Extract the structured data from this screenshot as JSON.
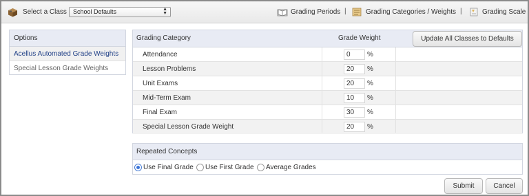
{
  "topbar": {
    "select_class_label": "Select a Class",
    "class_select": {
      "value": "School Defaults"
    },
    "links": {
      "grading_periods": "Grading Periods",
      "grading_categories": "Grading Categories / Weights",
      "grading_scale": "Grading Scale"
    },
    "separator": "|",
    "icons": [
      "box-icon",
      "book-icon",
      "folder-icon",
      "scale-icon"
    ]
  },
  "options": {
    "header": "Options",
    "items": [
      {
        "label": "Acellus Automated Grade Weights",
        "active": true
      },
      {
        "label": "Special Lesson Grade Weights",
        "active": false
      }
    ]
  },
  "grade_table": {
    "columns": {
      "category": "Grading Category",
      "weight": "Grade Weight"
    },
    "update_button": "Update All Classes to Defaults",
    "percent_symbol": "%",
    "rows": [
      {
        "category": "Attendance",
        "weight": "0"
      },
      {
        "category": "Lesson Problems",
        "weight": "20"
      },
      {
        "category": "Unit Exams",
        "weight": "20"
      },
      {
        "category": "Mid-Term Exam",
        "weight": "10"
      },
      {
        "category": "Final Exam",
        "weight": "30"
      },
      {
        "category": "Special Lesson Grade Weight",
        "weight": "20"
      }
    ]
  },
  "repeated_concepts": {
    "header": "Repeated Concepts",
    "options": [
      {
        "label": "Use Final Grade",
        "selected": true
      },
      {
        "label": "Use First Grade",
        "selected": false
      },
      {
        "label": "Average Grades",
        "selected": false
      }
    ]
  },
  "actions": {
    "submit": "Submit",
    "cancel": "Cancel"
  },
  "colors": {
    "header_bg": "#e8ebf4",
    "active_link": "#1f3f86",
    "radio_on": "#3b74d8"
  }
}
